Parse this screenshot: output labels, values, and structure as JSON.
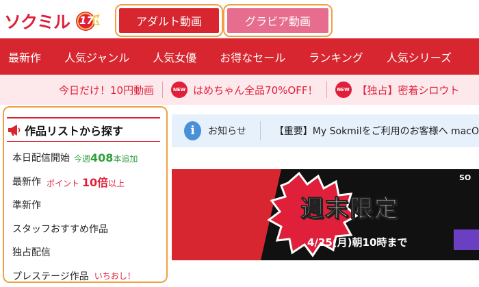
{
  "header": {
    "logo_text": "ソクミル",
    "logo_badge": "17th",
    "tabs": [
      {
        "label": "アダルト動画"
      },
      {
        "label": "グラビア動画"
      }
    ]
  },
  "nav": {
    "items": [
      {
        "label": "最新作"
      },
      {
        "label": "人気ジャンル"
      },
      {
        "label": "人気女優"
      },
      {
        "label": "お得なセール"
      },
      {
        "label": "ランキング"
      },
      {
        "label": "人気シリーズ"
      }
    ]
  },
  "promo": {
    "items": [
      {
        "label": "今日だけ！10円動画",
        "badge": ""
      },
      {
        "label": "はめちゃん全品70%OFF！",
        "badge": "NEW"
      },
      {
        "label": "【独占】密着シロウト",
        "badge": "NEW"
      }
    ]
  },
  "sidebar": {
    "title": "作品リストから探す",
    "items": [
      {
        "label": "本日配信開始",
        "note_pre": "今週",
        "note_num": "408",
        "note_post": "本追加"
      },
      {
        "label": "最新作",
        "note_pre": "ポイント",
        "note_num": "10倍",
        "note_post": "以上"
      },
      {
        "label": "準新作"
      },
      {
        "label": "スタッフおすすめ作品"
      },
      {
        "label": "独占配信"
      },
      {
        "label": "プレステージ作品",
        "note": "いちおし！"
      }
    ]
  },
  "notice": {
    "label": "お知らせ",
    "text": "【重要】My Sokmilをご利用のお客様へ macO"
  },
  "banner": {
    "headline": "週末限定",
    "subtext": "4/25(月)朝10時まで",
    "side_text": "SO"
  },
  "colors": {
    "brand_red": "#d7262f",
    "gravure_pink": "#e76d8e",
    "highlight_orange": "#f0a040",
    "promo_bg": "#fde9ec",
    "notice_bg": "#e7f1fb",
    "green": "#2e9e3a"
  },
  "icons": {
    "megaphone": "megaphone-icon",
    "info": "info-icon",
    "new_badge": "new-badge-icon"
  }
}
